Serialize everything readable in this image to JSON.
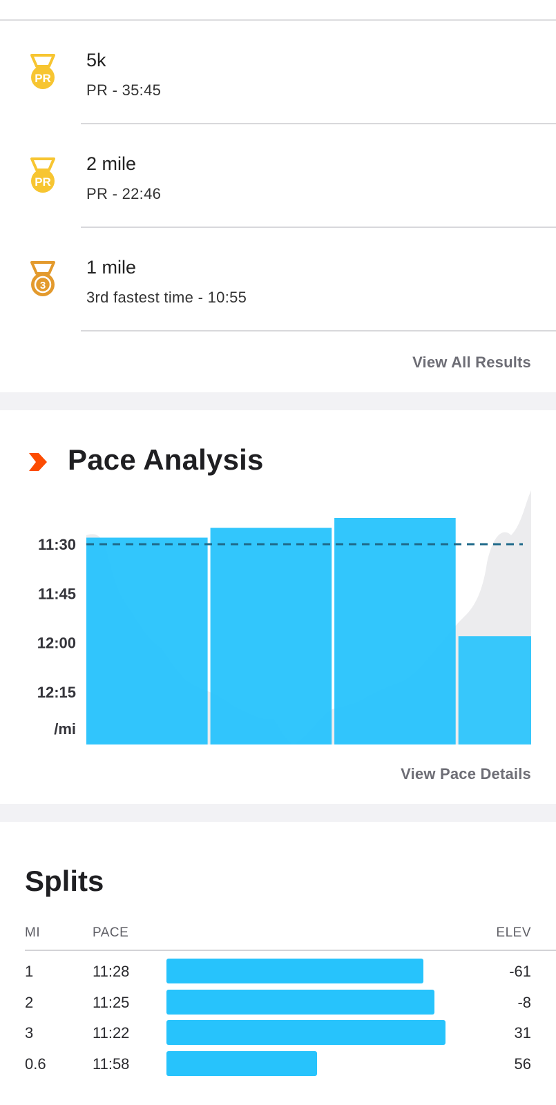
{
  "achievements": [
    {
      "title": "5k",
      "subtitle": "PR - 35:45",
      "badge": "PR",
      "badge_color": "#f7c531"
    },
    {
      "title": "2 mile",
      "subtitle": "PR - 22:46",
      "badge": "PR",
      "badge_color": "#f7c531"
    },
    {
      "title": "1 mile",
      "subtitle": "3rd fastest time - 10:55",
      "badge": "3",
      "badge_color": "#e39a2d"
    }
  ],
  "view_all_results_label": "View All Results",
  "pace_analysis": {
    "title": "Pace Analysis",
    "view_details_label": "View Pace Details",
    "accent_color": "#fc4c02",
    "bar_color": "#27c3fc",
    "avg_line_color": "#1f6a8a"
  },
  "chart_data": {
    "type": "bar",
    "y_ticks": [
      "11:30",
      "11:45",
      "12:00",
      "12:15"
    ],
    "y_unit": "/mi",
    "categories": [
      "1",
      "2",
      "3",
      "0.6"
    ],
    "values_pace": [
      "11:28",
      "11:25",
      "11:22",
      "11:58"
    ],
    "values_seconds_per_mile": [
      688,
      685,
      682,
      718
    ],
    "average_pace": "11:30",
    "bar_widths_mi": [
      1,
      1,
      1,
      0.6
    ]
  },
  "splits": {
    "title": "Splits",
    "headers": {
      "mi": "MI",
      "pace": "PACE",
      "elev": "ELEV"
    },
    "rows": [
      {
        "mi": "1",
        "pace": "11:28",
        "elev": "-61",
        "bar_fraction": 0.92
      },
      {
        "mi": "2",
        "pace": "11:25",
        "elev": "-8",
        "bar_fraction": 0.96
      },
      {
        "mi": "3",
        "pace": "11:22",
        "elev": "31",
        "bar_fraction": 1.0
      },
      {
        "mi": "0.6",
        "pace": "11:58",
        "elev": "56",
        "bar_fraction": 0.54
      }
    ]
  }
}
